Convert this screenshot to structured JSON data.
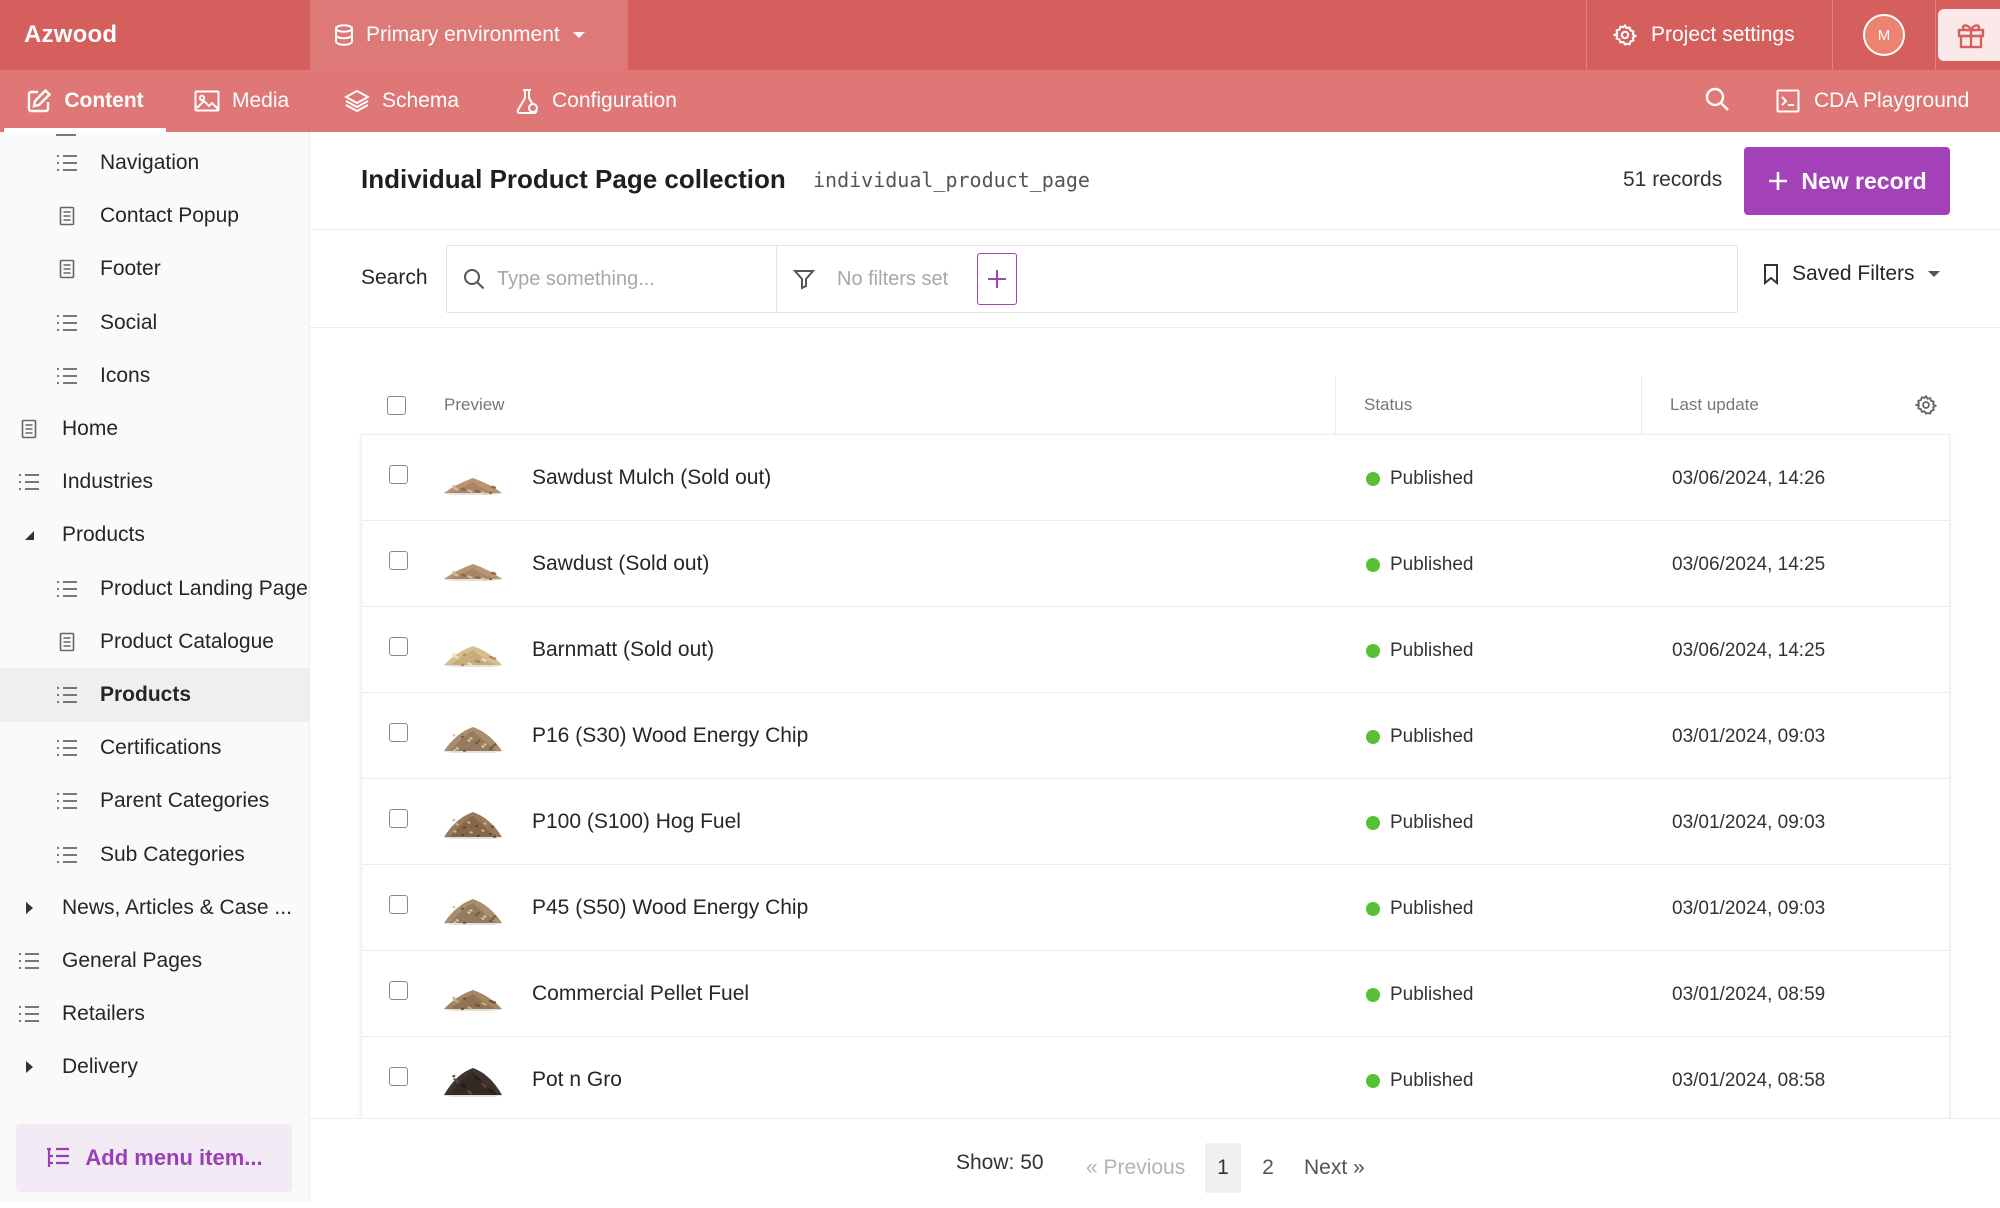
{
  "app": {
    "brand": "Azwood",
    "environment": "Primary environment",
    "project_settings": "Project settings",
    "avatar_initial": "M"
  },
  "subnav": {
    "tabs": [
      {
        "label": "Content",
        "icon": "edit-icon",
        "active": true
      },
      {
        "label": "Media",
        "icon": "image-icon"
      },
      {
        "label": "Schema",
        "icon": "layers-icon"
      },
      {
        "label": "Configuration",
        "icon": "flask-icon"
      }
    ],
    "cda_playground": "CDA Playground"
  },
  "sidebar": {
    "items": [
      {
        "label": "Navigation",
        "icon": "list-icon",
        "level": 2
      },
      {
        "label": "Contact Popup",
        "icon": "page-icon",
        "level": 2
      },
      {
        "label": "Footer",
        "icon": "page-icon",
        "level": 2
      },
      {
        "label": "Social",
        "icon": "list-icon",
        "level": 2
      },
      {
        "label": "Icons",
        "icon": "list-icon",
        "level": 2
      },
      {
        "label": "Home",
        "icon": "page-icon",
        "level": 1
      },
      {
        "label": "Industries",
        "icon": "list-icon",
        "level": 1
      },
      {
        "label": "Products",
        "icon": "caret-down-icon",
        "level": 1
      },
      {
        "label": "Product Landing Page",
        "icon": "list-icon",
        "level": 2
      },
      {
        "label": "Product Catalogue",
        "icon": "page-icon",
        "level": 2
      },
      {
        "label": "Products",
        "icon": "list-icon",
        "level": 2,
        "active": true
      },
      {
        "label": "Certifications",
        "icon": "list-icon",
        "level": 2
      },
      {
        "label": "Parent Categories",
        "icon": "list-icon",
        "level": 2
      },
      {
        "label": "Sub Categories",
        "icon": "list-icon",
        "level": 2
      },
      {
        "label": "News, Articles & Case ...",
        "icon": "caret-right-icon",
        "level": 1
      },
      {
        "label": "General Pages",
        "icon": "list-icon",
        "level": 1
      },
      {
        "label": "Retailers",
        "icon": "list-icon",
        "level": 1
      },
      {
        "label": "Delivery",
        "icon": "caret-right-icon",
        "level": 1
      }
    ],
    "add_menu_item": "Add menu item..."
  },
  "main": {
    "title": "Individual Product Page collection",
    "api_key": "individual_product_page",
    "record_count": "51 records",
    "new_record": "New record",
    "search_label": "Search",
    "search_placeholder": "Type something...",
    "filters_text": "No filters set",
    "saved_filters": "Saved Filters"
  },
  "table": {
    "columns": [
      "Preview",
      "Status",
      "Last update"
    ],
    "rows": [
      {
        "title": "Sawdust Mulch (Sold out)",
        "status": "Published",
        "updated": "03/06/2024, 14:26",
        "thumb": "sawdust"
      },
      {
        "title": "Sawdust (Sold out)",
        "status": "Published",
        "updated": "03/06/2024, 14:25",
        "thumb": "sawdust"
      },
      {
        "title": "Barnmatt (Sold out)",
        "status": "Published",
        "updated": "03/06/2024, 14:25",
        "thumb": "shavings"
      },
      {
        "title": "P16 (S30) Wood Energy Chip",
        "status": "Published",
        "updated": "03/01/2024, 09:03",
        "thumb": "chips"
      },
      {
        "title": "P100 (S100) Hog Fuel",
        "status": "Published",
        "updated": "03/01/2024, 09:03",
        "thumb": "hog"
      },
      {
        "title": "P45 (S50) Wood Energy Chip",
        "status": "Published",
        "updated": "03/01/2024, 09:03",
        "thumb": "chips"
      },
      {
        "title": "Commercial Pellet Fuel",
        "status": "Published",
        "updated": "03/01/2024, 08:59",
        "thumb": "pellet"
      },
      {
        "title": "Pot n Gro",
        "status": "Published",
        "updated": "03/01/2024, 08:58",
        "thumb": "soil"
      }
    ],
    "status_color": "#57c133"
  },
  "pagination": {
    "show": "Show: 50",
    "previous": "« Previous",
    "pages": [
      "1",
      "2"
    ],
    "current_page": "1",
    "next": "Next »"
  },
  "colors": {
    "topbar": "#d45f5d",
    "subnav": "#de7775",
    "accent": "#a341b8"
  }
}
